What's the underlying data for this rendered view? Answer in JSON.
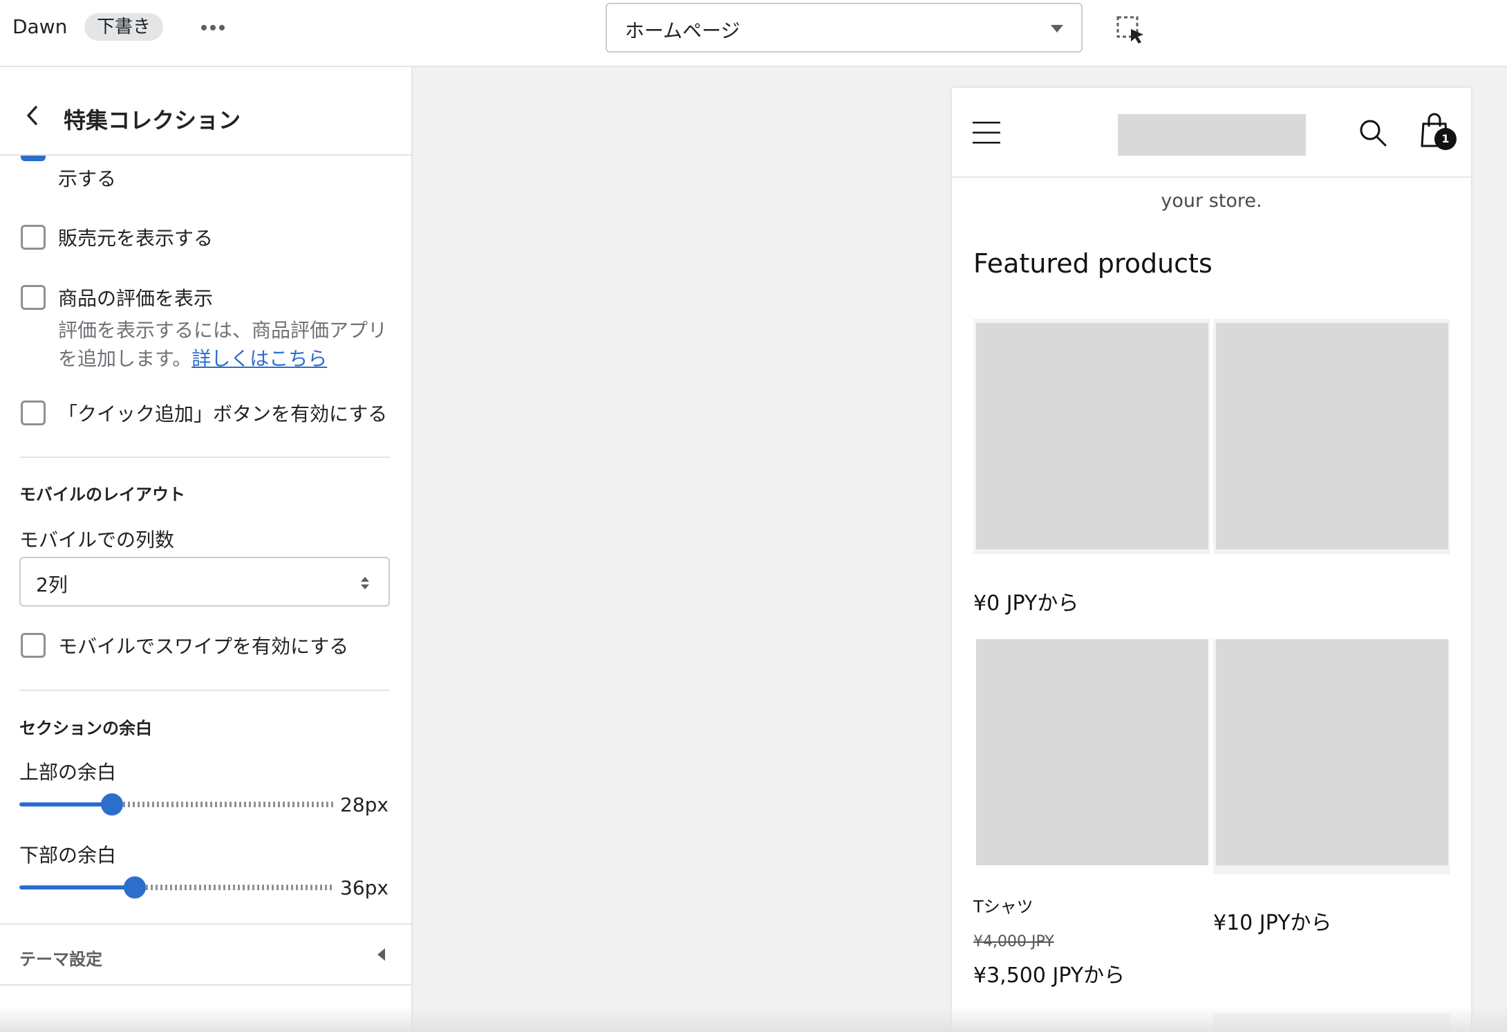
{
  "topbar": {
    "theme_name": "Dawn",
    "draft_badge": "下書き",
    "page_select_value": "ホームページ"
  },
  "sidebar": {
    "title": "特集コレクション",
    "partial_text": "示する",
    "checkboxes": [
      {
        "label": "販売元を表示する",
        "checked": false
      },
      {
        "label": "商品の評価を表示",
        "checked": false
      },
      {
        "label": "「クイック追加」ボタンを有効にする",
        "checked": false
      }
    ],
    "rating_help_text": "評価を表示するには、商品評価アプリを追加します。",
    "rating_help_link": "詳しくはこちら",
    "mobile_layout": {
      "heading": "モバイルのレイアウト",
      "columns_label": "モバイルでの列数",
      "columns_value": "2列",
      "swipe_label": "モバイルでスワイプを有効にする",
      "swipe_checked": false
    },
    "section_padding": {
      "heading": "セクションの余白",
      "top_label": "上部の余白",
      "top_value": "28px",
      "top_fraction": 0.28,
      "bottom_label": "下部の余白",
      "bottom_value": "36px",
      "bottom_fraction": 0.36
    },
    "theme_settings_label": "テーマ設定"
  },
  "preview": {
    "store_text": "your store.",
    "cart_count": "1",
    "section_title": "Featured products",
    "products": [
      {
        "price": "¥0 JPYから"
      },
      {
        "name": "Tシャツ",
        "compare_price": "¥4,000 JPY",
        "price": "¥3,500 JPYから"
      },
      {
        "price": "¥10 JPYから"
      }
    ]
  },
  "colors": {
    "accent": "#2c6ecb",
    "placeholder": "#d9d9d9"
  }
}
